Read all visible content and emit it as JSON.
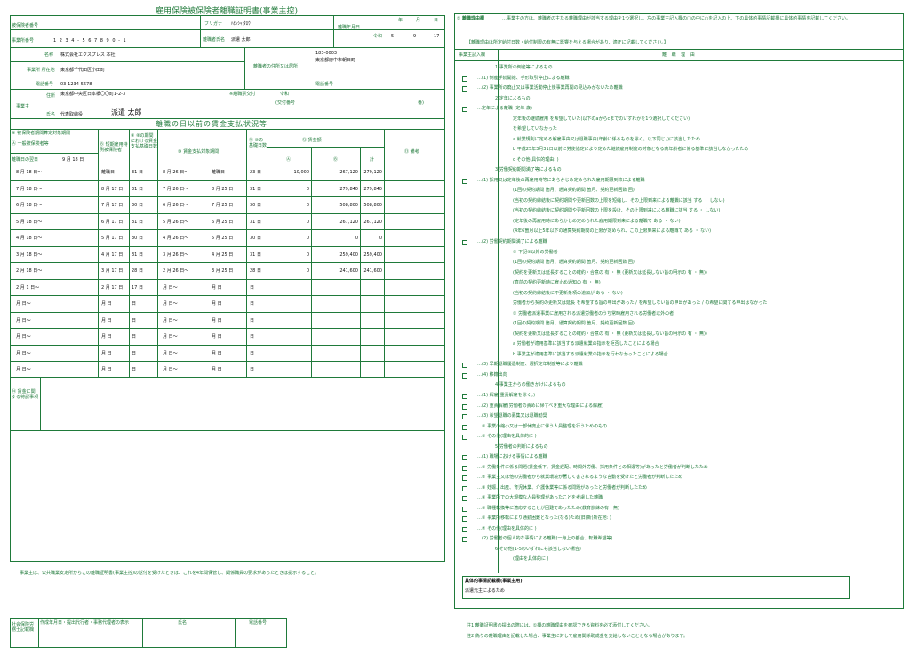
{
  "form": {
    "title": "雇用保険被保険者離職証明書(事業主控)",
    "insured_number_label": "被保険者番号",
    "office_number_label": "事業所番号",
    "office_number": "1 2 3 4 - 5 6 7 8 9 0 - 1",
    "furigana_label": "フリガナ",
    "furigana_value": "ﾊｹﾝｼｬ ﾀﾛｳ",
    "name_label": "離職者氏名",
    "name_value": "派遣 太郎",
    "separation_label": "離職年月日",
    "era_label": "令和",
    "sep_year": "5",
    "sep_month": "9",
    "sep_day": "17",
    "year_label": "年",
    "month_label": "月",
    "day_label": "日",
    "office_name_label": "名称",
    "office_name": "株式会社エクスプレス 本社",
    "office_addr_label": "事業所 所在地",
    "office_addr": "東京都千代田区小田町",
    "phone_label": "電話番号",
    "office_phone": "03-1234-5678",
    "employee_zip": "183-0003",
    "employee_addr_label": "離職者の住所又は居所",
    "employee_addr": "東京都府中市朝日町",
    "employee_phone_label": "電話番号",
    "employer_label": "事業主",
    "employer_addr_label": "住所",
    "employer_addr": "東京都中央区日本橋〇〇町1-2-3",
    "employer_name_label": "氏名",
    "employer_title": "代表取締役",
    "employer_name": "派遣 太郎",
    "issued_label": "※離職票交付",
    "issued_era": "令和",
    "issued_number": "(交付番号",
    "issued_number_end": "番)",
    "wage_header": "離職の日以前の賃金支払状況等",
    "col_a_header": "⑧ 被保険者期間算定対象期間",
    "col_a_sub": "Ⓐ 一般被保険者等",
    "col_a_first": "離職日の翌日",
    "col_a_first_val": "9 月 18 日",
    "col_b_sub": "Ⓑ 短期雇用特例被保険者",
    "col_9": "⑨ ⑧の期間における賃金支払基礎日数",
    "col_10": "⑩ 賃金支払対象期間",
    "col_11": "⑪ ⑩の基礎日数",
    "col_12": "⑫ 賃金額",
    "col_12a": "Ⓐ",
    "col_12b": "Ⓑ",
    "col_12c": "計",
    "col_13": "⑬ 備考",
    "remark_label": "⑭ 賃金に関する特記事項",
    "footer_note": "事業主は、公共職業安定所からこの離職証明書(事業主控)の返付を受けたときは、これを4年間保管し、関係職員の要求があったときは提示すること。",
    "agent_label": "社会保険労務士記載欄",
    "agent_col1": "作成年月日・提出代行者・事務代理者の表示",
    "agent_col2": "氏名",
    "agent_col3": "電話番号"
  },
  "rows": [
    {
      "a": "8 月 18 日〜",
      "b": "離職日",
      "days": "31 日",
      "period": "8 月 26 日〜",
      "period_end": "離職日",
      "base": "23 日",
      "amt_a": "10,000",
      "amt_b": "267,120",
      "total": "279,120"
    },
    {
      "a": "7 月 18 日〜",
      "b": "8 月 17 日",
      "days": "31 日",
      "period": "7 月 26 日〜",
      "period_end": "8 月 25 日",
      "base": "31 日",
      "amt_a": "0",
      "amt_b": "279,840",
      "total": "279,840"
    },
    {
      "a": "6 月 18 日〜",
      "b": "7 月 17 日",
      "days": "30 日",
      "period": "6 月 26 日〜",
      "period_end": "7 月 25 日",
      "base": "30 日",
      "amt_a": "0",
      "amt_b": "508,800",
      "total": "508,800"
    },
    {
      "a": "5 月 18 日〜",
      "b": "6 月 17 日",
      "days": "31 日",
      "period": "5 月 26 日〜",
      "period_end": "6 月 25 日",
      "base": "31 日",
      "amt_a": "0",
      "amt_b": "267,120",
      "total": "267,120"
    },
    {
      "a": "4 月 18 日〜",
      "b": "5 月 17 日",
      "days": "30 日",
      "period": "4 月 26 日〜",
      "period_end": "5 月 25 日",
      "base": "30 日",
      "amt_a": "0",
      "amt_b": "0",
      "total": "0"
    },
    {
      "a": "3 月 18 日〜",
      "b": "4 月 17 日",
      "days": "31 日",
      "period": "3 月 26 日〜",
      "period_end": "4 月 25 日",
      "base": "31 日",
      "amt_a": "0",
      "amt_b": "259,400",
      "total": "259,400"
    },
    {
      "a": "2 月 18 日〜",
      "b": "3 月 17 日",
      "days": "28 日",
      "period": "2 月 26 日〜",
      "period_end": "3 月 25 日",
      "base": "28 日",
      "amt_a": "0",
      "amt_b": "241,600",
      "total": "241,600"
    },
    {
      "a": "2 月 1 日〜",
      "b": "2 月 17 日",
      "days": "17 日",
      "period": "月 日〜",
      "period_end": "月 日",
      "base": "日",
      "amt_a": "",
      "amt_b": "",
      "total": ""
    },
    {
      "a": "月 日〜",
      "b": "月 日",
      "days": "日",
      "period": "月 日〜",
      "period_end": "月 日",
      "base": "日",
      "amt_a": "",
      "amt_b": "",
      "total": ""
    },
    {
      "a": "月 日〜",
      "b": "月 日",
      "days": "日",
      "period": "月 日〜",
      "period_end": "月 日",
      "base": "日",
      "amt_a": "",
      "amt_b": "",
      "total": ""
    },
    {
      "a": "月 日〜",
      "b": "月 日",
      "days": "日",
      "period": "月 日〜",
      "period_end": "月 日",
      "base": "日",
      "amt_a": "",
      "amt_b": "",
      "total": ""
    },
    {
      "a": "月 日〜",
      "b": "月 日",
      "days": "日",
      "period": "月 日〜",
      "period_end": "月 日",
      "base": "日",
      "amt_a": "",
      "amt_b": "",
      "total": ""
    },
    {
      "a": "月 日〜",
      "b": "月 日",
      "days": "日",
      "period": "月 日〜",
      "period_end": "月 日",
      "base": "日",
      "amt_a": "",
      "amt_b": "",
      "total": ""
    }
  ],
  "reason": {
    "header_label": "⑦ 離職理由欄",
    "header_note": "…事業主の方は、離職者の主たる離職理由が該当する理由を1つ選択し、左の事業主記入欄の□の中に○を記入の上、下の具体的事情記載欄に具体的事情を記載してください。",
    "sub_note": "【離職理由は所定給付日数・給付制限の有無に影響を与える場合があり、適正に記載してください。】",
    "col_left": "事業主記入欄",
    "col_right": "離 職 理 由",
    "lines": [
      "1 事業所の倒産等によるもの",
      "…(1) 倒産手続開始、手形取引停止による離職",
      "…(2) 事業所の廃止又は事業活動停止後事業再開の見込みがないため離職",
      "2 定年によるもの",
      "…定年による離職 (定年 歳)",
      "定年後の継続雇用 を希望していた(以下のaからcまでのいずれかを1つ選択してください)",
      "を希望していなかった",
      "a 就業規則に定める解雇事由又は退職事由(年齢に係るものを除く。以下同じ。)に該当したため",
      "b 平成25年3月31日以前に労使協定により定めた継続雇用制度の対象となる高年齢者に係る基準に該当しなかったため",
      "c その他(具体的理由: )",
      "3 労働契約期間満了等によるもの",
      "…(1) 採用又は定年後の再雇用時等にあらかじめ定められた雇用期限到来による離職",
      "(1回の契約期間 箇月、通算契約期間 箇月、契約更新回数 回)",
      "(当初の契約締結後に契約期間や更新回数の上限を短縮し、その上限到来による離職に該当 する ・ しない)",
      "(当初の契約締結後に契約期間や更新回数の上限を設け、その上限到来による離職に該当 する ・ しない)",
      "(定年後の再雇用時にあらかじめ定められた雇用期限到来による離職で ある ・ ない)",
      "(4年6箇月以上5年以下の通算契約期間の上限が定められ、この上限到来による離職で ある ・ ない)",
      "…(2) 労働契約期間満了による離職",
      "① 下記②以外の労働者",
      "(1回の契約期間 箇月、通算契約期間 箇月、契約更新回数 回)",
      "(契約を更新又は延長することの確約・合意の 有 ・ 無 (更新又は延長しない旨の明示の 有 ・ 無))",
      "(直前の契約更新時に雇止め通知の 有 ・ 無)",
      "(当初の契約締結後に不更新条項の追加が ある ・ ない)",
      "労働者から契約の更新又は延長 を希望する旨の申出があった / を希望しない旨の申出があった / の希望に関する申出はなかった",
      "② 労働者派遣事業に雇用される派遣労働者のうち常時雇用される労働者以外の者",
      "(1回の契約期間 箇月、通算契約期間 箇月、契約更新回数 回)",
      "(契約を更新又は延長することの確約・合意の 有 ・ 無 (更新又は延長しない旨の明示の 有 ・ 無))",
      "a 労働者が適用基準に該当する派遣就業の指示を拒否したことによる場合",
      "b 事業主が適用基準に該当する派遣就業の指示を行わなかったことによる場合",
      "…(3) 早期退職優遇制度、選択定年制度等により離職",
      "…(4) 移籍出向",
      "4 事業主からの働きかけによるもの",
      "…(1) 解雇(重責解雇を除く。)",
      "…(2) 重責解雇(労働者の責めに帰すべき重大な理由による解雇)",
      "…(3) 希望退職の募集又は退職勧奨",
      "…① 事業の縮小又は一部休廃止に伴う人員整理を行うためのもの",
      "…② その他(理由を具体的に )",
      "5 労働者の判断によるもの",
      "…(1) 職場における事情による離職",
      "…① 労働条件に係る問題(賃金低下、賃金遅配、時間外労働、採用条件との相違等)があったと労働者が判断したため",
      "…② 事業主又は他の労働者から就業環境が著しく害されるような言動を受けたと労働者が判断したため",
      "…③ 妊娠、出産、育児休業、介護休業等に係る問題があったと労働者が判断したため",
      "…④ 事業所での大規模な人員整理があったことを考慮した離職",
      "…⑤ 職種転換等に適応することが困難であったため(教育訓練の有・無)",
      "…⑥ 事業所移転により通勤困難となった(なる)ため(旧(新)所在地: )",
      "…⑦ その他(理由を具体的に )",
      "…(2) 労働者の個人的な事情による離職(一身上の都合、転職希望等)",
      "6 その他(1-5のいずれにも該当しない場合)",
      "(理由を具体的に )"
    ],
    "concrete_label": "具体的事情記載欄(事業主用)",
    "concrete_value": "派遣元主によるため",
    "note1": "注1 離職証明書の提出の際には、①欄の離職理由を確認できる資料を必ず添付してください。",
    "note2": "注2 偽りの離職理由を記載した場合、事業主に対して雇用関係助成金を支給しないこととなる場合があります。"
  }
}
